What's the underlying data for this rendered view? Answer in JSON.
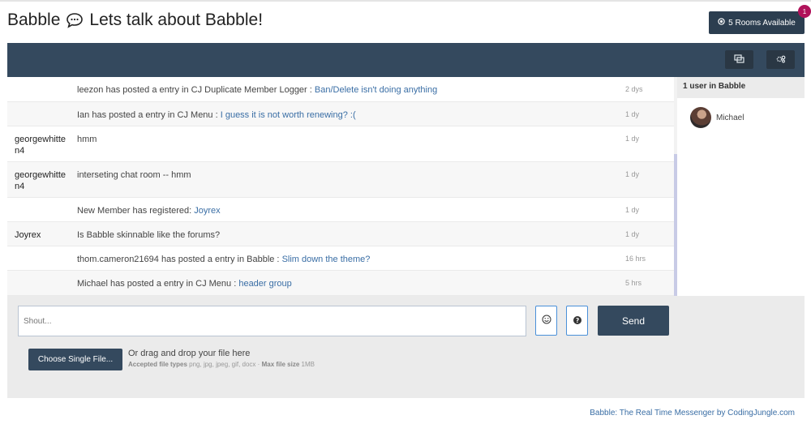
{
  "header": {
    "app_name": "Babble",
    "tagline": "Lets talk about Babble!",
    "rooms_button": "5 Rooms Available",
    "rooms_badge": "1"
  },
  "messages": [
    {
      "user": "",
      "text": "leezon has posted a entry in CJ Duplicate Member Logger : ",
      "link": "Ban/Delete isn't doing anything",
      "time": "2 dys"
    },
    {
      "user": "",
      "text": "Ian has posted a entry in CJ Menu : ",
      "link": "I guess it is not worth renewing? :(",
      "time": "1 dy"
    },
    {
      "user": "georgewhitten4",
      "text": "hmm",
      "link": "",
      "time": "1 dy"
    },
    {
      "user": "georgewhitten4",
      "text": "interseting chat room -- hmm",
      "link": "",
      "time": "1 dy"
    },
    {
      "user": "",
      "text": "New Member has registered: ",
      "link": "Joyrex",
      "time": "1 dy"
    },
    {
      "user": "Joyrex",
      "text": "Is Babble skinnable like the forums?",
      "link": "",
      "time": "1 dy"
    },
    {
      "user": "",
      "text": "thom.cameron21694 has posted a entry in Babble : ",
      "link": "Slim down the theme?",
      "time": "16 hrs"
    },
    {
      "user": "",
      "text": "Michael has posted a entry in CJ Menu : ",
      "link": "header group",
      "time": "5 hrs"
    }
  ],
  "sidebar": {
    "heading": "1 user in Babble",
    "users": [
      {
        "name": "Michael"
      }
    ]
  },
  "composer": {
    "placeholder": "Shout...",
    "emoji_icon": "smiley-icon",
    "help_icon": "question-icon",
    "send_label": "Send",
    "choose_label": "Choose Single File...",
    "drop_text": "Or drag and drop your file here",
    "accepted_label": "Accepted file types",
    "accepted_types": "png, jpg, jpeg, gif, docx",
    "max_label": "Max file size",
    "max_size": "1MB"
  },
  "footer": {
    "credit": "Babble: The Real Time Messenger by CodingJungle.com"
  },
  "colors": {
    "bar": "#34495e",
    "badge": "#b0125a",
    "link": "#3a6ea5"
  }
}
